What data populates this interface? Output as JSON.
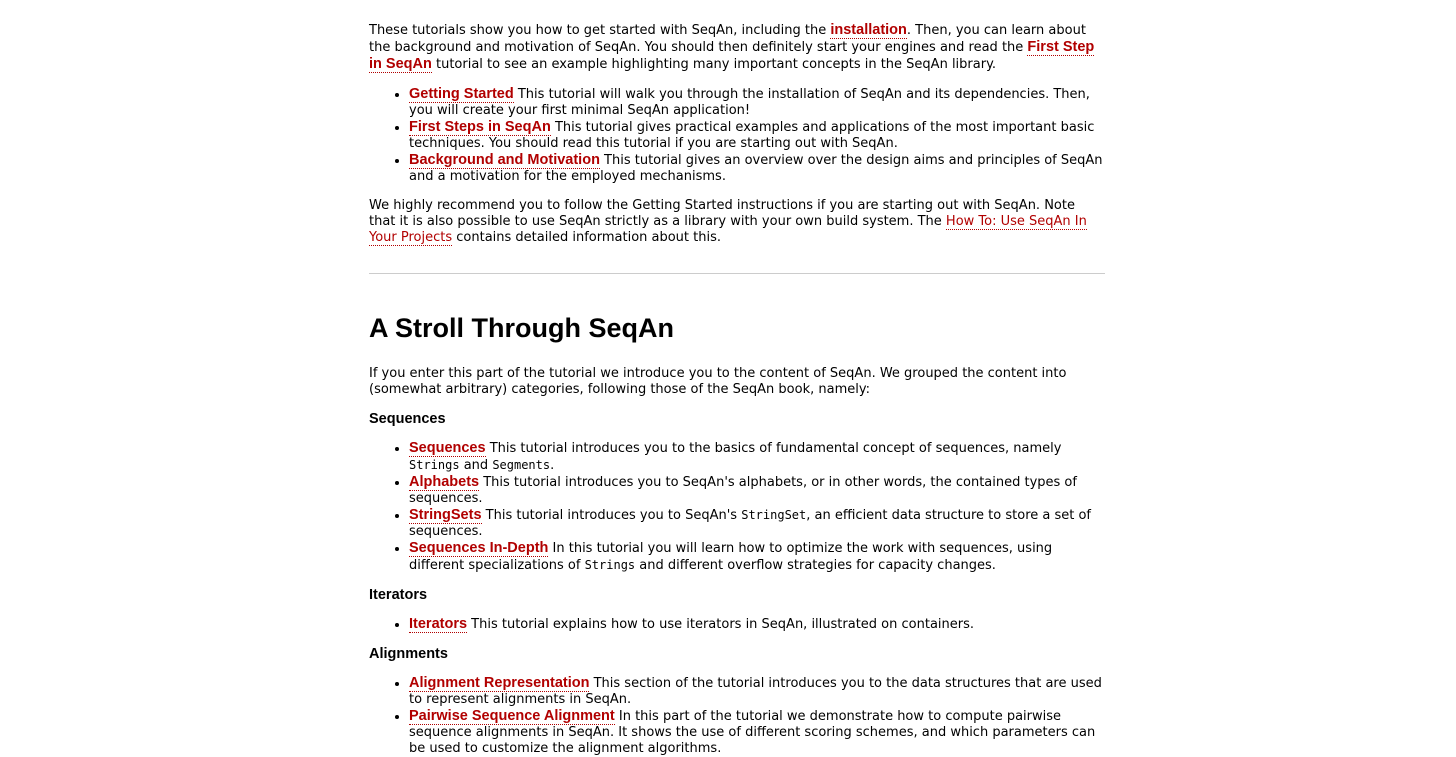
{
  "intro": {
    "t1": "These tutorials show you how to get started with SeqAn, including the ",
    "link_installation": "installation",
    "t2": ". Then, you can learn about the background and motivation of SeqAn. You should then definitely start your engines and read the ",
    "link_first_step": "First Step in SeqAn",
    "t3": " tutorial to see an example highlighting many important concepts in the SeqAn library."
  },
  "intro_list": [
    {
      "link": "Getting Started",
      "text": " This tutorial will walk you through the installation of SeqAn and its dependencies. Then, you will create your first minimal SeqAn application!"
    },
    {
      "link": "First Steps in SeqAn",
      "text": " This tutorial gives practical examples and applications of the most important basic techniques. You should read this tutorial if you are starting out with SeqAn."
    },
    {
      "link": "Background and Motivation",
      "text": " This tutorial gives an overview over the design aims and principles of SeqAn and a motivation for the employed mechanisms."
    }
  ],
  "recommend": {
    "t1": "We highly recommend you to follow the Getting Started instructions if you are starting out with SeqAn. Note that it is also possible to use SeqAn strictly as a library with your own build system. The ",
    "link": "How To: Use SeqAn In Your Projects",
    "t2": " contains detailed information about this."
  },
  "stroll": {
    "title": "A Stroll Through SeqAn",
    "intro": "If you enter this part of the tutorial we introduce you to the content of SeqAn. We grouped the content into (somewhat arbitrary) categories, following those of the SeqAn book, namely:"
  },
  "sequences": {
    "heading": "Sequences",
    "items": [
      {
        "link": "Sequences",
        "t1": " This tutorial introduces you to the basics of fundamental concept of sequences, namely ",
        "code1": "Strings",
        "t2": " and ",
        "code2": "Segments",
        "t3": "."
      },
      {
        "link": "Alphabets",
        "t1": " This tutorial introduces you to SeqAn's alphabets, or in other words, the contained types of sequences."
      },
      {
        "link": "StringSets",
        "t1": " This tutorial introduces you to SeqAn's ",
        "code1": "StringSet",
        "t2": ", an efficient data structure to store a set of sequences."
      },
      {
        "link": "Sequences In-Depth",
        "t1": " In this tutorial you will learn how to optimize the work with sequences, using different specializations of ",
        "code1": "Strings",
        "t2": " and different overflow strategies for capacity changes."
      }
    ]
  },
  "iterators": {
    "heading": "Iterators",
    "items": [
      {
        "link": "Iterators",
        "t1": " This tutorial explains how to use iterators in SeqAn, illustrated on containers."
      }
    ]
  },
  "alignments": {
    "heading": "Alignments",
    "items": [
      {
        "link": "Alignment Representation",
        "t1": " This section of the tutorial introduces you to the data structures that are used to represent alignments in SeqAn."
      },
      {
        "link": "Pairwise Sequence Alignment",
        "t1": " In this part of the tutorial we demonstrate how to compute pairwise sequence alignments in SeqAn. It shows the use of different scoring schemes, and which parameters can be used to customize the alignment algorithms."
      }
    ]
  },
  "colors": {
    "link": "#b10000",
    "text": "#000000",
    "rule": "#cccccc"
  }
}
